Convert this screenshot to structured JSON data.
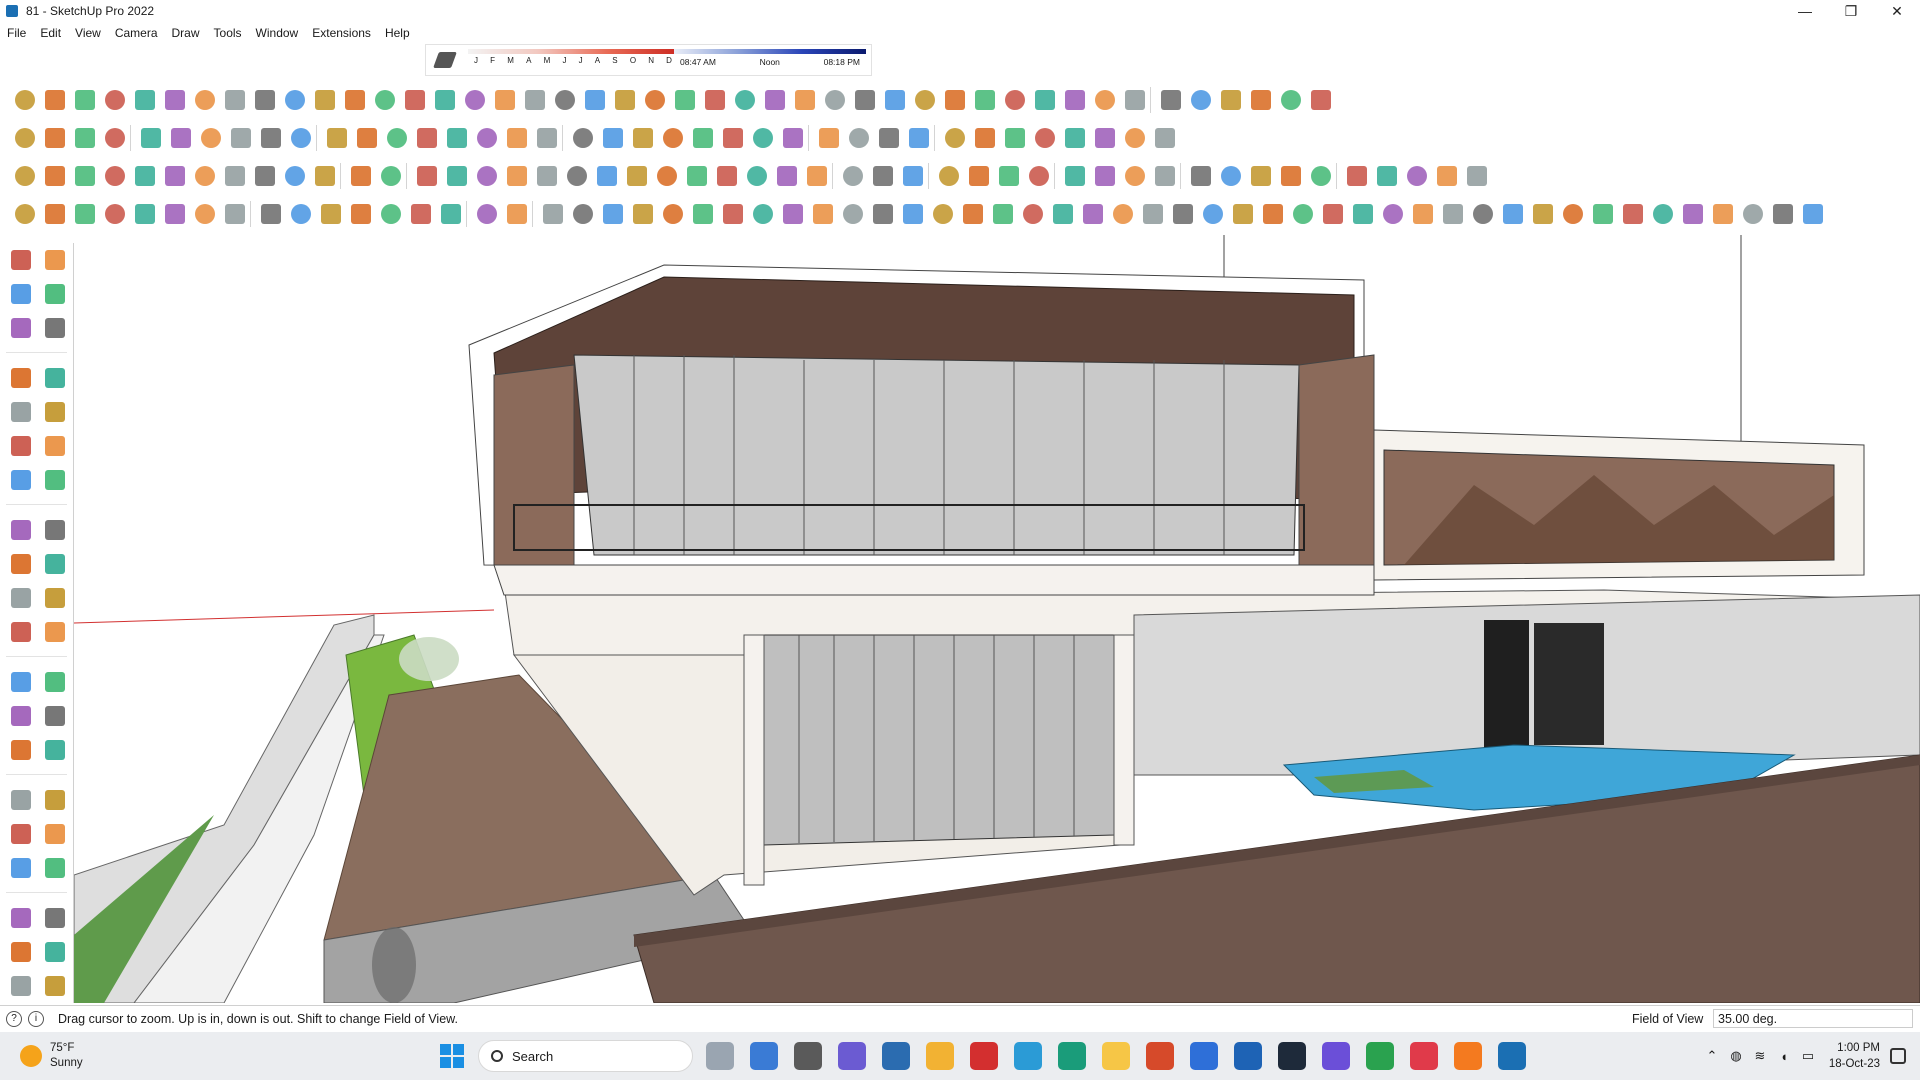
{
  "window": {
    "title": "81 - SketchUp Pro 2022",
    "minimize": "—",
    "maximize": "❐",
    "close": "✕"
  },
  "menu": [
    "File",
    "Edit",
    "View",
    "Camera",
    "Draw",
    "Tools",
    "Window",
    "Extensions",
    "Help"
  ],
  "shadows": {
    "months": [
      "J",
      "F",
      "M",
      "A",
      "M",
      "J",
      "J",
      "A",
      "S",
      "O",
      "N",
      "D"
    ],
    "time_start": "08:47 AM",
    "time_mid": "Noon",
    "time_end": "08:18 PM"
  },
  "colors": {
    "accent": "#1b6fb3",
    "wall": "#8b6a5a",
    "roof": "#5e4339",
    "glass": "#c9c9c9",
    "pool": "#3fa6d8",
    "grass": "#6fae3a",
    "deck": "#8a6e5e",
    "parapet": "#6f574d"
  },
  "status": {
    "hint": "Drag cursor to zoom.  Up is in, down is out. Shift to change Field of View.",
    "vcb_label": "Field of View",
    "vcb_value": "35.00 deg."
  },
  "taskbar": {
    "temperature": "75°F",
    "condition": "Sunny",
    "search": "Search",
    "time": "1:00 PM",
    "date": "18-Oct-23"
  }
}
